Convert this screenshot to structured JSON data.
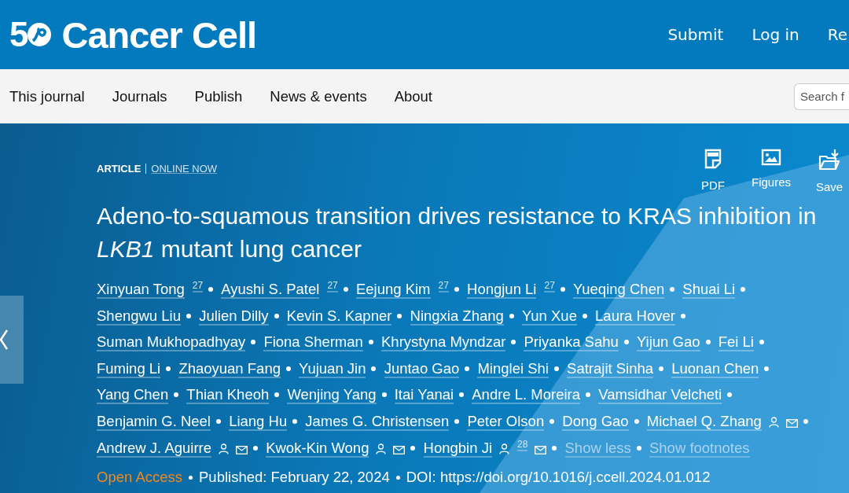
{
  "header": {
    "logo_mark": "5",
    "journal": "Cancer Cell",
    "links": [
      "Submit",
      "Log in",
      "Re"
    ]
  },
  "nav": {
    "items": [
      "This journal",
      "Journals",
      "Publish",
      "News & events",
      "About"
    ],
    "search": {
      "placeholder": "Search f"
    }
  },
  "article": {
    "type": "ARTICLE",
    "status": "ONLINE NOW",
    "actions": [
      {
        "kind": "pdf",
        "label": "PDF"
      },
      {
        "kind": "figures",
        "label": "Figures"
      },
      {
        "kind": "save",
        "label": "Save"
      }
    ],
    "title": "Adeno-to-squamous transition drives resistance to KRAS inhibition in *LKB1* mutant lung cancer",
    "authors": [
      {
        "name": "Xinyuan Tong",
        "note": "27",
        "contact": false
      },
      {
        "name": "Ayushi S. Patel",
        "note": "27",
        "contact": false
      },
      {
        "name": "Eejung Kim",
        "note": "27",
        "contact": false
      },
      {
        "name": "Hongjun Li",
        "note": "27",
        "contact": false
      },
      {
        "name": "Yueqing Chen",
        "contact": false
      },
      {
        "name": "Shuai Li",
        "contact": false
      },
      {
        "name": "Shengwu Liu",
        "contact": false
      },
      {
        "name": "Julien Dilly",
        "contact": false
      },
      {
        "name": "Kevin S. Kapner",
        "contact": false
      },
      {
        "name": "Ningxia Zhang",
        "contact": false
      },
      {
        "name": "Yun Xue",
        "contact": false
      },
      {
        "name": "Laura Hover",
        "contact": false
      },
      {
        "name": "Suman Mukhopadhyay",
        "contact": false
      },
      {
        "name": "Fiona Sherman",
        "contact": false
      },
      {
        "name": "Khrystyna Myndzar",
        "contact": false
      },
      {
        "name": "Priyanka Sahu",
        "contact": false
      },
      {
        "name": "Yijun Gao",
        "contact": false
      },
      {
        "name": "Fei Li",
        "contact": false
      },
      {
        "name": "Fuming Li",
        "contact": false
      },
      {
        "name": "Zhaoyuan Fang",
        "contact": false
      },
      {
        "name": "Yujuan Jin",
        "contact": false
      },
      {
        "name": "Juntao Gao",
        "contact": false
      },
      {
        "name": "Minglei Shi",
        "contact": false
      },
      {
        "name": "Satrajit Sinha",
        "contact": false
      },
      {
        "name": "Luonan Chen",
        "contact": false
      },
      {
        "name": "Yang Chen",
        "contact": false
      },
      {
        "name": "Thian Kheoh",
        "contact": false
      },
      {
        "name": "Wenjing Yang",
        "contact": false
      },
      {
        "name": "Itai Yanai",
        "contact": false
      },
      {
        "name": "Andre L. Moreira",
        "contact": false
      },
      {
        "name": "Vamsidhar Velcheti",
        "contact": false
      },
      {
        "name": "Benjamin G. Neel",
        "contact": false
      },
      {
        "name": "Liang Hu",
        "contact": false
      },
      {
        "name": "James G. Christensen",
        "contact": false
      },
      {
        "name": "Peter Olson",
        "contact": false
      },
      {
        "name": "Dong Gao",
        "contact": false
      },
      {
        "name": "Michael Q. Zhang",
        "contact": true
      },
      {
        "name": "Andrew J. Aguirre",
        "contact": true
      },
      {
        "name": "Kwok-Kin Wong",
        "contact": true
      },
      {
        "name": "Hongbin Ji",
        "note": "28",
        "contact": true
      }
    ],
    "author_links": [
      "Show less",
      "Show footnotes"
    ],
    "access": "Open Access",
    "published": "Published: February 22, 2024",
    "doi": "DOI: https://doi.org/10.1016/j.ccell.2024.01.012"
  }
}
